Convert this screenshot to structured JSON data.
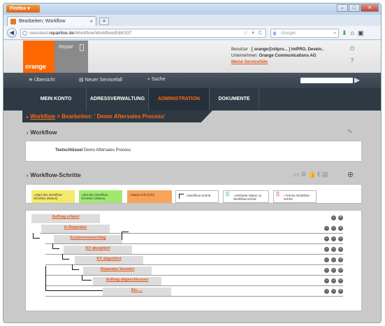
{
  "browser": {
    "app_button": "Firefox",
    "tab_title": "Bearbeiten: Workflow",
    "url_prefix": "swisstest.",
    "url_host": "repairline.de",
    "url_path": "/Workflow/Workflow/Edit/337",
    "search_engine_letter": "g",
    "search_placeholder": "Google"
  },
  "header": {
    "logo_text": "orange",
    "repair_text": "Repair",
    "user_label": "Benutzer :",
    "user_value": "[ orange@nitpro... ] IntPRO, Develo..",
    "company_label": "Unternehmen:",
    "company_value": "Orange Communications AG",
    "service_link": "Meine Servicefälle"
  },
  "toolbar": {
    "overview": "Übersicht",
    "new_case": "Neuer Servicefall",
    "search": "Suche"
  },
  "mainnav": {
    "items": [
      "MEIN KONTO",
      "ADRESSVERWALTUNG",
      "ADMINISTRATION",
      "DOKUMENTE"
    ]
  },
  "breadcrumb": {
    "link": "Workflow",
    "sep": " > ",
    "current": "Bearbeiten: ' Demo Aftersales Process'"
  },
  "workflow_section": {
    "title": "Workflow",
    "key_label": "Textschlüssel",
    "key_value": "Demo Aftersales Process"
  },
  "steps_section": {
    "title": "Workflow-Schritte"
  },
  "legend": [
    {
      "text": "=Start des Workflow-Schrittes (Status)",
      "color": "#f5e96a"
    },
    {
      "text": "=Ziel des Workflow-Schrittes (Status)",
      "color": "#9fea6e"
    },
    {
      "text": "=Status-Info (Info)",
      "color": "#f7a35a"
    },
    {
      "text": "=Workflow-Schritt",
      "color": "#ffffff"
    },
    {
      "text": "=Verbinde Status zu Workflow-Schritt",
      "color": "#ffffff"
    },
    {
      "text": "=Trenne Workflow-Schritt",
      "color": "#ffffff"
    }
  ],
  "steps": [
    {
      "label": "Auftrag erfasst"
    },
    {
      "label": "In Reparatur"
    },
    {
      "label": "Kostenvoranschlag"
    },
    {
      "label": "KV akzeptiert"
    },
    {
      "label": "KV abgelehnt"
    },
    {
      "label": "Reparatur beendet"
    },
    {
      "label": "Auftrag abgeschlossen"
    },
    {
      "label": "Etc....."
    }
  ],
  "colors": {
    "accent": "#ff6600",
    "link": "#e2561a",
    "nav_dark": "#2e3943"
  }
}
